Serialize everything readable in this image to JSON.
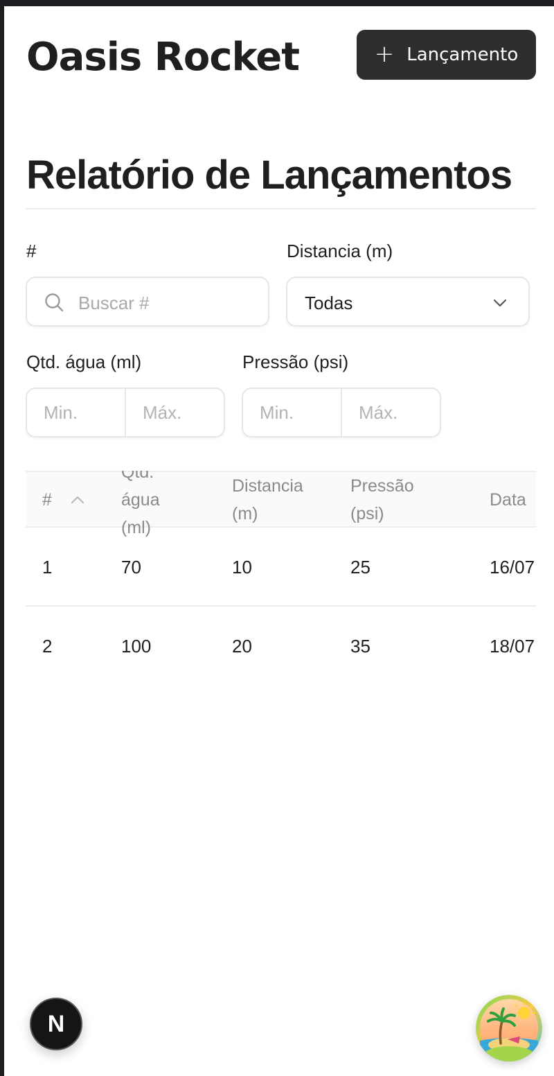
{
  "header": {
    "brand": "Oasis Rocket",
    "new_button_label": "Lançamento"
  },
  "page": {
    "title": "Relatório de Lançamentos"
  },
  "filters": {
    "id_label": "#",
    "search_placeholder": "Buscar #",
    "distance_label": "Distancia (m)",
    "distance_selected": "Todas",
    "water_label": "Qtd. água (ml)",
    "pressure_label": "Pressão (psi)",
    "min_placeholder": "Min.",
    "max_placeholder": "Máx."
  },
  "table": {
    "columns": [
      {
        "key": "id",
        "label": "#",
        "sorted": "asc"
      },
      {
        "key": "water",
        "label": "Qtd. água (ml)"
      },
      {
        "key": "distance",
        "label": "Distancia (m)"
      },
      {
        "key": "pressure",
        "label": "Pressão (psi)"
      },
      {
        "key": "date",
        "label": "Data"
      }
    ],
    "header_lines": {
      "id": "#",
      "water_1": "Qtd.",
      "water_2": "água",
      "water_3": "(ml)",
      "distance_1": "Distancia",
      "distance_2": "(m)",
      "pressure_1": "Pressão",
      "pressure_2": "(psi)",
      "date": "Data"
    },
    "rows": [
      {
        "id": "1",
        "water": "70",
        "distance": "10",
        "pressure": "25",
        "date": "16/07"
      },
      {
        "id": "2",
        "water": "100",
        "distance": "20",
        "pressure": "35",
        "date": "18/07"
      }
    ]
  },
  "overlay": {
    "dev_badge": "N"
  },
  "colors": {
    "primary_button": "#2e2e2e",
    "text": "#1f1f1f",
    "muted": "#8a8a8a",
    "border": "#e6e6e6"
  },
  "icons": {
    "new_button": "plus-icon",
    "search": "search-icon",
    "select": "chevron-down-icon",
    "sort": "chevron-up-icon",
    "avatar": "palm-island-avatar-icon"
  }
}
